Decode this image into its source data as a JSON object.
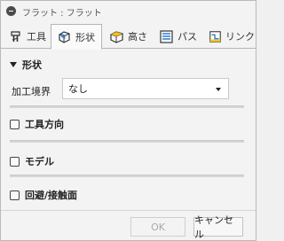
{
  "window": {
    "title": "フラット : フラット"
  },
  "tabs": [
    {
      "label": "工具",
      "icon": "tool-icon"
    },
    {
      "label": "形状",
      "icon": "shape-icon",
      "active": true
    },
    {
      "label": "高さ",
      "icon": "height-icon"
    },
    {
      "label": "パス",
      "icon": "path-icon"
    },
    {
      "label": "リンク",
      "icon": "link-icon"
    }
  ],
  "sections": {
    "shape": {
      "title": "形状",
      "expanded": true,
      "field_label": "加工境界",
      "field_value": "なし"
    },
    "tool_orientation": {
      "title": "工具方向",
      "checked": false
    },
    "model": {
      "title": "モデル",
      "checked": false
    },
    "avoid_touch": {
      "title": "回避/接触面",
      "checked": false
    }
  },
  "buttons": {
    "ok": "OK",
    "cancel": "キャンセル"
  },
  "colors": {
    "accent_blue": "#2b7cd3",
    "yellow": "#f3c316",
    "background": "#f3f3f3"
  }
}
